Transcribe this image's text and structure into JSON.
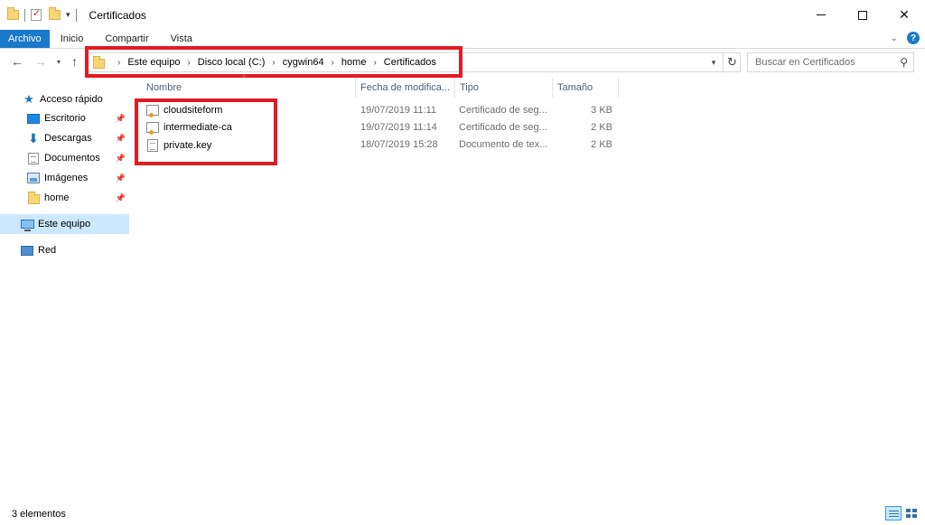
{
  "window": {
    "title": "Certificados",
    "controls": {
      "minimize": "minimize-icon",
      "maximize": "maximize-icon",
      "close": "✕"
    }
  },
  "ribbon": {
    "tabs": [
      {
        "label": "Archivo",
        "active": true
      },
      {
        "label": "Inicio"
      },
      {
        "label": "Compartir"
      },
      {
        "label": "Vista"
      }
    ],
    "help": "?"
  },
  "address": {
    "breadcrumbs": [
      "Este equipo",
      "Disco local (C:)",
      "cygwin64",
      "home",
      "Certificados"
    ],
    "search_placeholder": "Buscar en Certificados"
  },
  "sidebar": {
    "quick_access": "Acceso rápido",
    "items": [
      {
        "label": "Escritorio",
        "icon": "desktop-icon",
        "pinned": true
      },
      {
        "label": "Descargas",
        "icon": "download-icon",
        "pinned": true
      },
      {
        "label": "Documentos",
        "icon": "documents-icon",
        "pinned": true
      },
      {
        "label": "Imágenes",
        "icon": "pictures-icon",
        "pinned": true
      },
      {
        "label": "home",
        "icon": "folder-icon",
        "pinned": true
      }
    ],
    "this_pc": "Este equipo",
    "network": "Red"
  },
  "columns": {
    "name": "Nombre",
    "date": "Fecha de modifica...",
    "type": "Tipo",
    "size": "Tamaño"
  },
  "files": [
    {
      "name": "cloudsiteform",
      "date": "19/07/2019 11:11",
      "type": "Certificado de seg...",
      "size": "3 KB",
      "icon": "certificate-icon"
    },
    {
      "name": "intermediate-ca",
      "date": "19/07/2019 11:14",
      "type": "Certificado de seg...",
      "size": "2 KB",
      "icon": "certificate-icon"
    },
    {
      "name": "private.key",
      "date": "18/07/2019 15:28",
      "type": "Documento de tex...",
      "size": "2 KB",
      "icon": "text-file-icon"
    }
  ],
  "status": {
    "count": "3 elementos"
  },
  "colors": {
    "accent": "#1979ca",
    "highlight": "#e21b23",
    "selected": "#cce8ff"
  }
}
